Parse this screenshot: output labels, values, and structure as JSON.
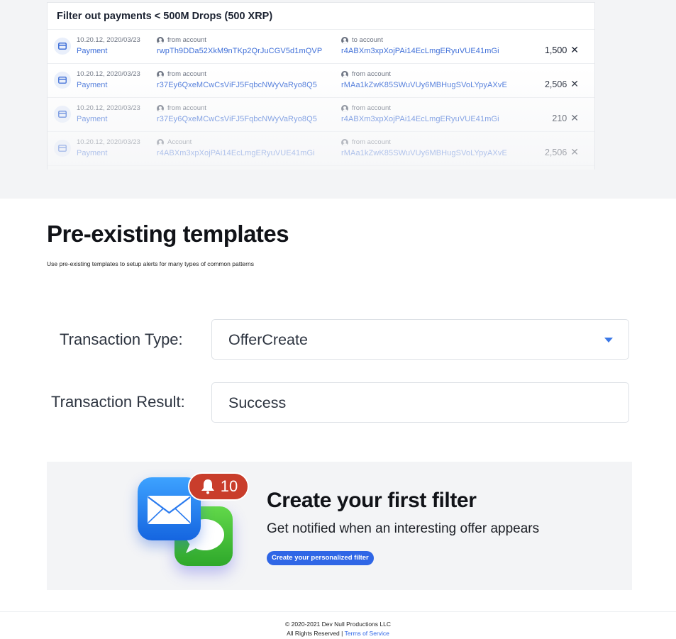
{
  "payments_card": {
    "title": "Filter out payments < 500M Drops (500 XRP)",
    "rows": [
      {
        "timestamp": "10.20.12, 2020/03/23",
        "type": "Payment",
        "col_a_label": "from account",
        "col_a_address": "rwpTh9DDa52XkM9nTKp2QrJuCGV5d1mQVP",
        "col_b_label": "to account",
        "col_b_address": "r4ABXm3xpXojPAi14EcLmgERyuVUE41mGi",
        "amount": "1,500"
      },
      {
        "timestamp": "10.20.12, 2020/03/23",
        "type": "Payment",
        "col_a_label": "from account",
        "col_a_address": "r37Ey6QxeMCwCsViFJ5FqbcNWyVaRyo8Q5",
        "col_b_label": "from account",
        "col_b_address": "rMAa1kZwK85SWuVUy6MBHugSVoLYpyAXvE",
        "amount": "2,506"
      },
      {
        "timestamp": "10.20.12, 2020/03/23",
        "type": "Payment",
        "col_a_label": "from account",
        "col_a_address": "r37Ey6QxeMCwCsViFJ5FqbcNWyVaRyo8Q5",
        "col_b_label": "from account",
        "col_b_address": "r4ABXm3xpXojPAi14EcLmgERyuVUE41mGi",
        "amount": "210"
      },
      {
        "timestamp": "10.20.12, 2020/03/23",
        "type": "Payment",
        "col_a_label": "Account",
        "col_a_address": "r4ABXm3xpXojPAi14EcLmgERyuVUE41mGi",
        "col_b_label": "from account",
        "col_b_address": "rMAa1kZwK85SWuVUy6MBHugSVoLYpyAXvE",
        "amount": "2,506"
      }
    ]
  },
  "templates": {
    "title": "Pre-existing templates",
    "subtitle": "Use pre-existing templates to setup alerts for many types of common patterns",
    "transaction_type_label": "Transaction Type:",
    "transaction_type_value": "OfferCreate",
    "transaction_result_label": "Transaction Result:",
    "transaction_result_value": "Success"
  },
  "cta": {
    "title": "Create your first filter",
    "subtitle": "Get notified when an interesting offer appears",
    "button_label": "Create your personalized filter",
    "badge_count": "10"
  },
  "footer": {
    "copyright": "© 2020-2021 Dev Null Productions LLC",
    "rights": "All Rights Reserved",
    "separator": "|",
    "terms_link": "Terms of Service"
  },
  "colors": {
    "accent": "#2f66e6",
    "link": "#3f6fd8",
    "badge": "#c93d2b"
  }
}
